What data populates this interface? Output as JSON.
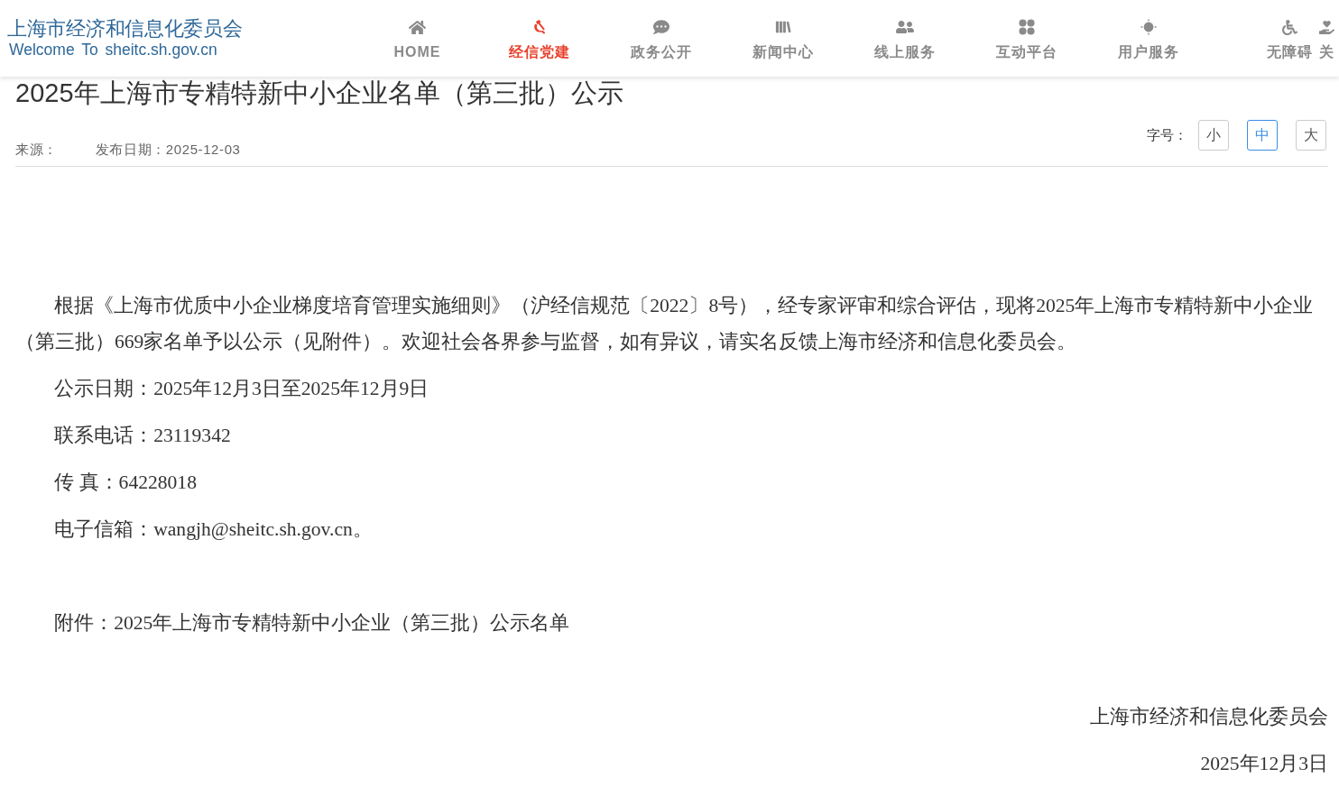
{
  "header": {
    "logo": {
      "title": "上海市经济和信息化委员会",
      "subtitle": "Welcome To sheitc.sh.gov.cn"
    },
    "nav": [
      {
        "label": "HOME",
        "selected": false
      },
      {
        "label": "经信党建",
        "selected": true
      },
      {
        "label": "政务公开",
        "selected": false
      },
      {
        "label": "新闻中心",
        "selected": false
      },
      {
        "label": "线上服务",
        "selected": false
      },
      {
        "label": "互动平台",
        "selected": false
      },
      {
        "label": "用户服务",
        "selected": false
      }
    ],
    "utility_links": [
      {
        "label": "无障碍"
      },
      {
        "label": "关"
      }
    ]
  },
  "article": {
    "title": "2025年上海市专精特新中小企业名单（第三批）公示",
    "meta": {
      "source": "来源：",
      "published": "发布日期：2025-12-03"
    },
    "font_size": {
      "label": "字号：",
      "options": [
        {
          "label": "小",
          "selected": false
        },
        {
          "label": "中",
          "selected": true
        },
        {
          "label": "大",
          "selected": false
        }
      ]
    },
    "paragraphs": [
      "根据《上海市优质中小企业梯度培育管理实施细则》（沪经信规范〔2022〕8号），经专家评审和综合评估，现将2025年上海市专精特新中小企业（第三批）669家名单予以公示（见附件）。欢迎社会各界参与监督，如有异议，请实名反馈上海市经济和信息化委员会。",
      "公示日期：2025年12月3日至2025年12月9日",
      "联系电话：23119342",
      "传 真：64228018",
      "电子信箱：wangjh@sheitc.sh.gov.cn。"
    ],
    "attachment": "附件：2025年上海市专精特新中小企业（第三批）公示名单",
    "signature": {
      "organization": "上海市经济和信息化委员会",
      "date": "2025年12月3日"
    }
  }
}
